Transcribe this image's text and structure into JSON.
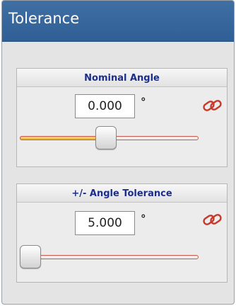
{
  "panel": {
    "title": "Tolerance"
  },
  "nominal_angle": {
    "label": "Nominal Angle",
    "value": "0.000",
    "unit": "°",
    "link_icon": "chain-link-icon",
    "slider_level": 0.48
  },
  "angle_tolerance": {
    "label": "+/- Angle Tolerance",
    "value": "5.000",
    "unit": "°",
    "link_icon": "chain-link-icon",
    "slider_level": 0.0
  },
  "colors": {
    "header_blue": "#3566a0",
    "group_title": "#1b2e8c",
    "link_icon": "#c8392b",
    "slider_fill": "#f0c04a",
    "slider_border": "#c45a4e"
  }
}
